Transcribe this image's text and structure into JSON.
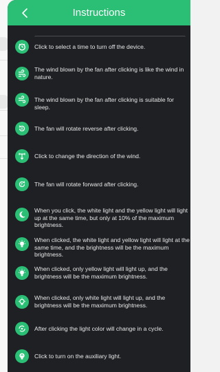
{
  "header": {
    "title": "Instructions",
    "back_icon": "chevron-left-icon",
    "color": "#2bbf75"
  },
  "colors": {
    "sheet_background": "#1e2024",
    "accent": "#2bbf75",
    "text": "#e7e7e7"
  },
  "items": [
    {
      "icon": "timer-icon",
      "text": "Click to select a time to turn off the device."
    },
    {
      "icon": "natural-wind-icon",
      "text": "The wind blown by the fan after clicking is like the wind in nature."
    },
    {
      "icon": "sleep-wind-icon",
      "text": "The wind blown by the fan after clicking is suitable for sleep."
    },
    {
      "icon": "reverse-rotation-icon",
      "text": "The fan will rotate reverse after clicking."
    },
    {
      "icon": "wind-direction-icon",
      "text": "Click to change the direction of the wind."
    },
    {
      "icon": "forward-rotation-icon",
      "text": "The fan will rotate forward after clicking."
    },
    {
      "icon": "night-light-icon",
      "text": "When you click, the white light and the yellow light will light up at the same time, but only at 10% of the maximum brightness."
    },
    {
      "icon": "bulb-mixed-icon",
      "text": "When clicked, the white light and yellow light will light at the same time, and the brightness will be the maximum brightness."
    },
    {
      "icon": "bulb-yellow-icon",
      "text": "When clicked, only yellow light will light up, and the brightness will be the maximum brightness."
    },
    {
      "icon": "bulb-white-icon",
      "text": "When clicked, only white light will light up, and the brightness will be the maximum brightness."
    },
    {
      "icon": "color-cycle-icon",
      "text": "After clicking the light color will change in a cycle."
    },
    {
      "icon": "auxiliary-light-icon",
      "text": "Click to turn on the auxiliary light."
    }
  ]
}
